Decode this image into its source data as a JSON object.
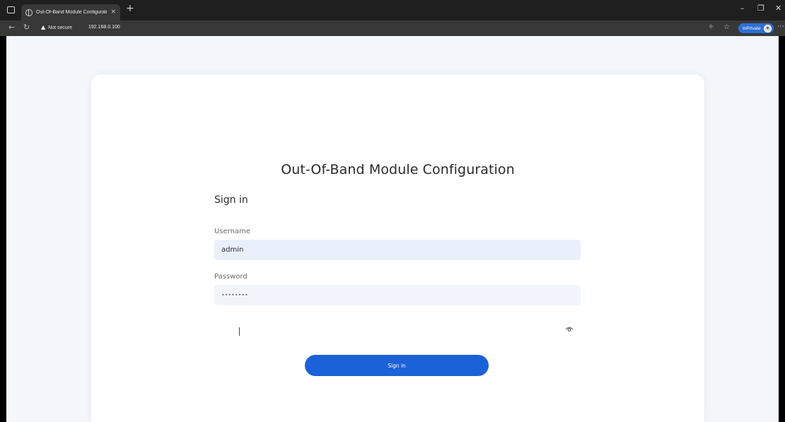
{
  "browser": {
    "tab_title": "Out-Of-Band Module Configurati",
    "tab_close": "×",
    "new_tab": "+",
    "window_controls": {
      "minimize": "–",
      "restore": "❐",
      "close": "✕"
    },
    "back": "←",
    "reload": "↻",
    "security_label": "Not secure",
    "url": "192.168.0.100",
    "inprivate_label": "InPrivate",
    "more": "⋯",
    "icons": [
      "window-menu-icon",
      "globe-favicon-icon",
      "warning-icon",
      "read-aloud-icon",
      "favorites-star-icon",
      "avatar-icon"
    ]
  },
  "page": {
    "title": "Out-Of-Band Module Configuration",
    "form": {
      "heading": "Sign in",
      "username_label": "Username",
      "username_value": "admin",
      "password_label": "Password",
      "password_mask": "••••••••",
      "submit_label": "Sign in"
    }
  },
  "colors": {
    "page_background": "#f3f6fa",
    "card_background": "#ffffff",
    "input_background": "#e9f0fb",
    "button_background": "#1b62d8",
    "browser_chrome": "#1f1f1f",
    "inprivate_badge": "#2f6fd6"
  }
}
